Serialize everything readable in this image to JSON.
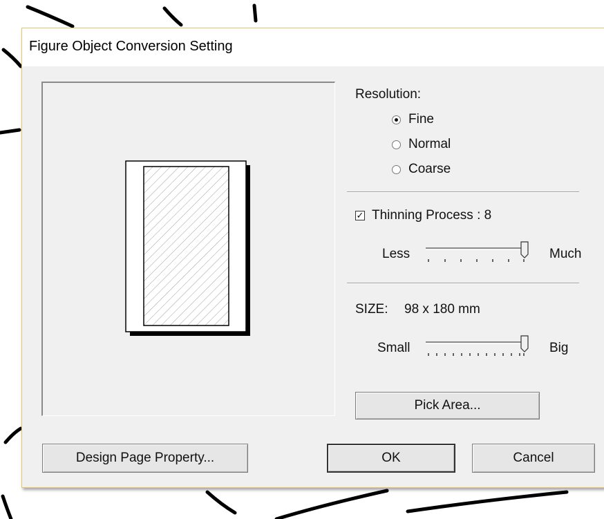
{
  "dialog": {
    "title": "Figure Object Conversion Setting"
  },
  "resolution": {
    "label": "Resolution:",
    "options": [
      "Fine",
      "Normal",
      "Coarse"
    ],
    "selected": "Fine"
  },
  "thinning": {
    "label": "Thinning Process : 8",
    "checked": true,
    "min_label": "Less",
    "max_label": "Much",
    "value": 8
  },
  "size": {
    "label": "SIZE:",
    "value": "98 x 180 mm",
    "min_label": "Small",
    "max_label": "Big",
    "slider_fraction": 1.0
  },
  "buttons": {
    "pick_area": "Pick Area...",
    "design_page_property": "Design Page Property...",
    "ok": "OK",
    "cancel": "Cancel"
  },
  "colors": {
    "dialog_bg": "#f0f0f0",
    "dialog_border": "#e5c46f",
    "title_bg": "#ffffff"
  }
}
